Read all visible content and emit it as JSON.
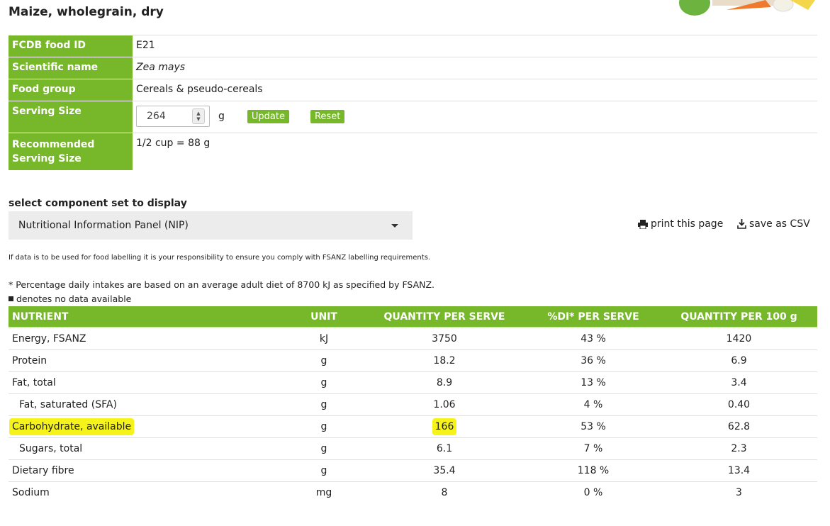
{
  "food": {
    "title": "Maize, wholegrain, dry"
  },
  "info": {
    "id_label": "FCDB food ID",
    "id_value": "E21",
    "sci_label": "Scientific name",
    "sci_value": "Zea mays",
    "group_label": "Food group",
    "group_value": "Cereals & pseudo-cereals",
    "serving_label": "Serving Size",
    "serving_value": "264",
    "serving_unit": "g",
    "update_label": "Update",
    "reset_label": "Reset",
    "rec_label_line1": "Recommended",
    "rec_label_line2": "Serving Size",
    "rec_value": "1/2 cup = 88 g"
  },
  "selector": {
    "label": "select component set to display",
    "selected": "Nutritional Information Panel (NIP)"
  },
  "actions": {
    "print": "print this page",
    "csv": "save as CSV"
  },
  "notes": {
    "labelling": "If data is to be used for food labelling it is your responsibility to ensure you comply with FSANZ labelling requirements.",
    "percent": "* Percentage daily intakes are based on an average adult diet of 8700 kJ as specified by FSANZ.",
    "nodata": "denotes no data available"
  },
  "table": {
    "headers": [
      "NUTRIENT",
      "UNIT",
      "QUANTITY PER SERVE",
      "%DI* PER SERVE",
      "QUANTITY PER 100 g"
    ],
    "rows": [
      {
        "name": "Energy, FSANZ",
        "unit": "kJ",
        "serve": "3750",
        "di": "43 %",
        "per100": "1420"
      },
      {
        "name": "Protein",
        "unit": "g",
        "serve": "18.2",
        "di": "36 %",
        "per100": "6.9"
      },
      {
        "name": "Fat, total",
        "unit": "g",
        "serve": "8.9",
        "di": "13 %",
        "per100": "3.4"
      },
      {
        "name": "Fat, saturated (SFA)",
        "unit": "g",
        "serve": "1.06",
        "di": "4 %",
        "per100": "0.40"
      },
      {
        "name": "Carbohydrate, available",
        "unit": "g",
        "serve": "166",
        "di": "53 %",
        "per100": "62.8"
      },
      {
        "name": "Sugars, total",
        "unit": "g",
        "serve": "6.1",
        "di": "7 %",
        "per100": "2.3"
      },
      {
        "name": "Dietary fibre",
        "unit": "g",
        "serve": "35.4",
        "di": "118 %",
        "per100": "13.4"
      },
      {
        "name": "Sodium",
        "unit": "mg",
        "serve": "8",
        "di": "0 %",
        "per100": "3"
      }
    ]
  },
  "colors": {
    "accent_green": "#77b72a",
    "highlight_yellow": "#f5f31a"
  }
}
